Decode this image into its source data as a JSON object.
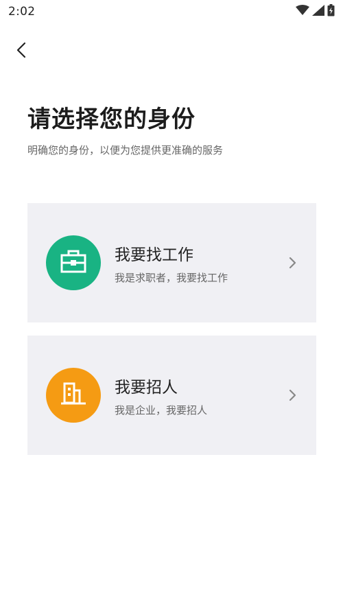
{
  "status_bar": {
    "time": "2:02",
    "icons": [
      "wifi-icon",
      "signal-icon",
      "battery-icon"
    ]
  },
  "header": {
    "back_icon": "chevron-left-icon",
    "title": "请选择您的身份",
    "subtitle": "明确您的身份，以便为您提供更准确的服务"
  },
  "roles": [
    {
      "title": "我要找工作",
      "description": "我是求职者，我要找工作",
      "icon": "briefcase-icon",
      "color": "#19b383"
    },
    {
      "title": "我要招人",
      "description": "我是企业，我要招人",
      "icon": "building-icon",
      "color": "#f59b13"
    }
  ],
  "colors": {
    "card_background": "#f0f0f4",
    "title_text": "#1c1c1c",
    "secondary_text": "#666666"
  }
}
